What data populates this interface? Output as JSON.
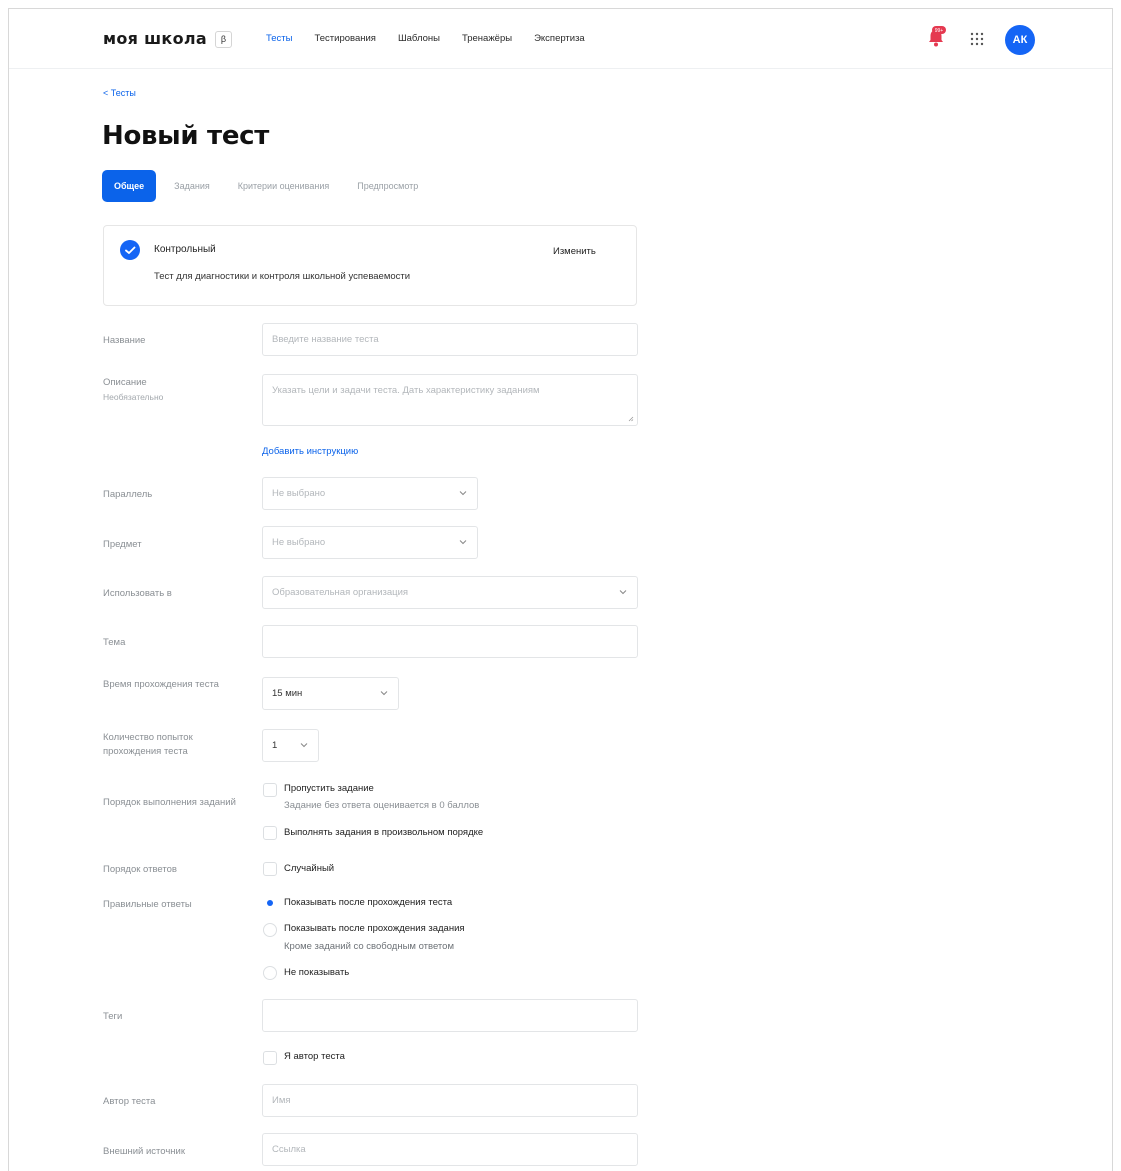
{
  "header": {
    "logo": "моя школа",
    "logo_badge": "β",
    "nav": [
      "Тесты",
      "Тестирования",
      "Шаблоны",
      "Тренажёры",
      "Экспертиза"
    ],
    "bell_badge": "99+",
    "avatar": "АК"
  },
  "breadcrumb": "< Тесты",
  "page_title": "Новый тест",
  "tabs": [
    "Общее",
    "Задания",
    "Критерии оценивания",
    "Предпросмотр"
  ],
  "card": {
    "title": "Контрольный",
    "description": "Тест для диагностики и контроля школьной успеваемости",
    "edit_label": "Изменить"
  },
  "form": {
    "name": {
      "label": "Название",
      "placeholder": "Введите название теста"
    },
    "description": {
      "label": "Описание",
      "label_note": "Необязательно",
      "placeholder": "Указать цели и задачи теста. Дать характеристику заданиям"
    },
    "add_instruction": "Добавить инструкцию",
    "parallel": {
      "label": "Параллель",
      "value": "Не выбрано"
    },
    "subject": {
      "label": "Предмет",
      "value": "Не выбрано"
    },
    "use_in": {
      "label": "Использовать в",
      "value": "Образовательная организация"
    },
    "topic": {
      "label": "Тема",
      "value": ""
    },
    "duration": {
      "label": "Время прохождения теста",
      "value": "15 мин"
    },
    "attempts": {
      "label": "Количество попыток прохождения теста",
      "value": "1"
    },
    "task_order": {
      "label": "Порядок выполнения заданий",
      "skip": "Пропустить задание",
      "skip_note": "Задание без ответа оценивается в 0 баллов",
      "random_order": "Выполнять задания в произвольном порядке"
    },
    "answer_order": {
      "label": "Порядок ответов",
      "option": "Случайный"
    },
    "correct_answers": {
      "label": "Правильные ответы",
      "options": [
        "Показывать после прохождения теста",
        "Показывать после прохождения задания",
        "Не показывать"
      ],
      "option2_note": "Кроме заданий со свободным ответом",
      "selected_index": 0
    },
    "tags": {
      "label": "Теги",
      "value": ""
    },
    "i_am_author": "Я автор теста",
    "author": {
      "label": "Автор теста",
      "placeholder": "Имя"
    },
    "source": {
      "label": "Внешний источник",
      "placeholder": "Ссылка"
    }
  },
  "colors": {
    "accent": "#0b63ea",
    "avatar_bg": "#1565f5",
    "bell": "#e53950"
  }
}
